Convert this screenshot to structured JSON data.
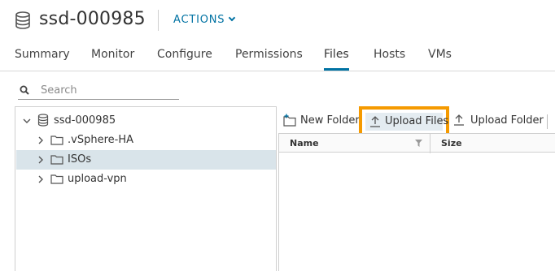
{
  "header": {
    "title": "ssd-000985",
    "icon": "datastore-icon",
    "actions_label": "ACTIONS"
  },
  "tabs": [
    {
      "label": "Summary"
    },
    {
      "label": "Monitor"
    },
    {
      "label": "Configure"
    },
    {
      "label": "Permissions"
    },
    {
      "label": "Files",
      "active": true
    },
    {
      "label": "Hosts"
    },
    {
      "label": "VMs"
    }
  ],
  "search": {
    "placeholder": "Search"
  },
  "tree": {
    "root": {
      "label": "ssd-000985",
      "icon": "datastore-icon",
      "expanded": true
    },
    "items": [
      {
        "label": ".vSphere-HA",
        "icon": "folder-icon",
        "selected": false
      },
      {
        "label": "ISOs",
        "icon": "folder-icon",
        "selected": true
      },
      {
        "label": "upload-vpn",
        "icon": "folder-icon",
        "selected": false
      }
    ]
  },
  "toolbar": {
    "new_folder": "New Folder",
    "upload_files": "Upload Files",
    "upload_folder": "Upload Folder"
  },
  "grid": {
    "columns": [
      "Name",
      "Size"
    ]
  },
  "colors": {
    "accent": "#0072a3",
    "highlight": "#f59a00",
    "selected_row": "#d9e4ea"
  }
}
